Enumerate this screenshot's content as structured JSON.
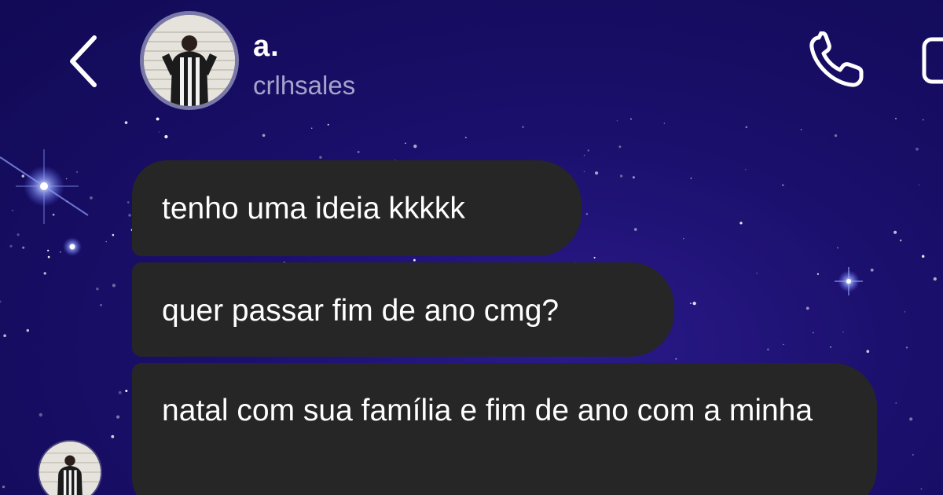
{
  "header": {
    "name": "a.",
    "username": "crlhsales",
    "back_icon": "chevron-left-icon",
    "call_icon": "phone-icon",
    "video_icon": "video-camera-icon"
  },
  "messages": [
    {
      "text": "tenho uma ideia kkkkk"
    },
    {
      "text": "quer passar fim de ano cmg?"
    },
    {
      "text": "natal com sua família e fim de ano com a minha"
    }
  ],
  "colors": {
    "background": "#1a0f6b",
    "bubble": "#262626",
    "username": "#a7a4cc",
    "avatar_ring": "#7a78a6"
  }
}
